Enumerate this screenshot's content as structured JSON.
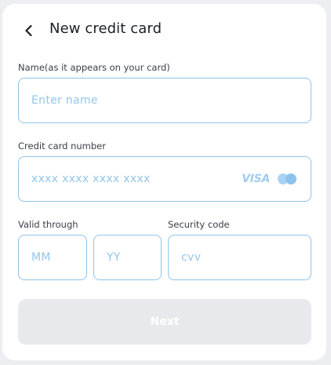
{
  "header": {
    "title": "New credit card",
    "back_icon": "chevron-left-icon"
  },
  "form": {
    "name": {
      "label": "Name(as it appears on your card)",
      "placeholder": "Enter name",
      "value": ""
    },
    "card_number": {
      "label": "Credit card number",
      "placeholder": "xxxx xxxx xxxx xxxx",
      "value": "",
      "brands": [
        "VISA",
        "mastercard-icon"
      ]
    },
    "valid_through": {
      "label": "Valid through",
      "month_placeholder": "MM",
      "year_placeholder": "YY"
    },
    "security_code": {
      "label": "Security code",
      "placeholder": "cvv"
    }
  },
  "actions": {
    "next_label": "Next",
    "next_enabled": false
  },
  "colors": {
    "border": "#8ec3e6",
    "placeholder": "#93c6ea",
    "disabled_button": "#e8e9ec",
    "title": "#1c1f28"
  }
}
